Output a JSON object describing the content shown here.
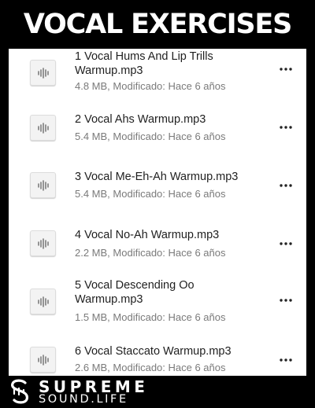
{
  "header": {
    "title": "VOCAL EXERCISES"
  },
  "files": [
    {
      "name": "1 Vocal Hums And Lip Trills Warmup.mp3",
      "meta": "4.8 MB, Modificado: Hace 6 años",
      "icon": "audio-file-icon"
    },
    {
      "name": "2 Vocal Ahs Warmup.mp3",
      "meta": "5.4 MB, Modificado: Hace 6 años",
      "icon": "audio-file-icon"
    },
    {
      "name": "3 Vocal Me-Eh-Ah Warmup.mp3",
      "meta": "5.4 MB, Modificado: Hace 6 años",
      "icon": "audio-file-icon"
    },
    {
      "name": "4 Vocal No-Ah Warmup.mp3",
      "meta": "2.2 MB, Modificado: Hace 6 años",
      "icon": "audio-file-icon"
    },
    {
      "name": "5 Vocal Descending Oo Warmup.mp3",
      "meta": "1.5 MB, Modificado: Hace 6 años",
      "icon": "audio-file-icon"
    },
    {
      "name": "6 Vocal Staccato Warmup.mp3",
      "meta": "2.6 MB, Modificado: Hace 6 años",
      "icon": "audio-file-icon"
    }
  ],
  "more_icon": "more-horizontal-icon",
  "footer": {
    "brand_line1": "SUPREME",
    "brand_line2": "SOUND.LIFE",
    "logo_icon": "supreme-sound-logo-icon"
  }
}
